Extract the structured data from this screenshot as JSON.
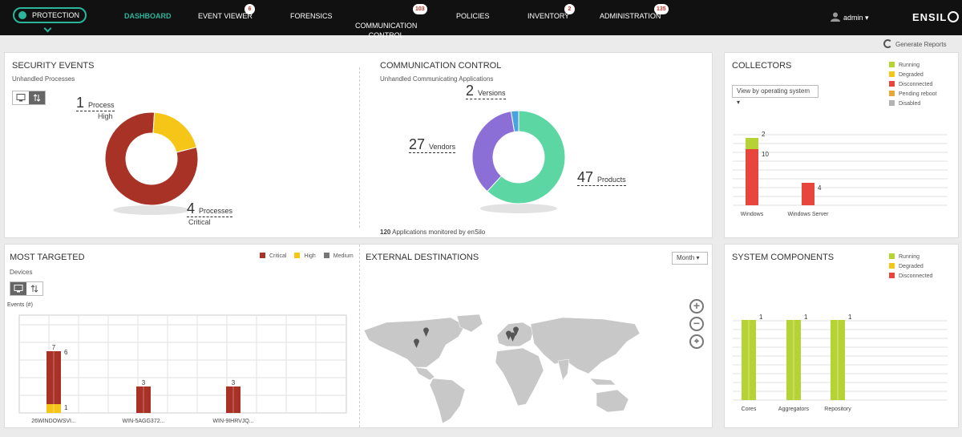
{
  "nav": {
    "protection": "PROTECTION",
    "items": [
      {
        "label": "DASHBOARD",
        "badge": ""
      },
      {
        "label": "EVENT VIEWER",
        "badge": "6"
      },
      {
        "label": "FORENSICS",
        "badge": ""
      },
      {
        "label": "COMMUNICATION\nCONTROL",
        "badge": "103"
      },
      {
        "label": "POLICIES",
        "badge": ""
      },
      {
        "label": "INVENTORY",
        "badge": "2"
      },
      {
        "label": "ADMINISTRATION",
        "badge": "135"
      }
    ],
    "user": "admin",
    "logo": "ENSIL"
  },
  "toolbar": {
    "generate_reports": "Generate Reports"
  },
  "security_events": {
    "title": "SECURITY EVENTS",
    "subtitle": "Unhandled Processes",
    "high_count": "1",
    "high_unit": "Process",
    "high_label": "High",
    "critical_count": "4",
    "critical_unit": "Processes",
    "critical_label": "Critical"
  },
  "communication_control": {
    "title": "COMMUNICATION CONTROL",
    "subtitle": "Unhandled Communicating Applications",
    "versions_count": "2",
    "versions_label": "Versions",
    "vendors_count": "27",
    "vendors_label": "Vendors",
    "products_count": "47",
    "products_label": "Products",
    "footer_count": "120",
    "footer_text": "Applications monitored by enSilo"
  },
  "collectors": {
    "title": "COLLECTORS",
    "dropdown": "View by operating system",
    "legend": [
      {
        "label": "Running",
        "color": "#b5d334"
      },
      {
        "label": "Degraded",
        "color": "#f5c518"
      },
      {
        "label": "Disconnected",
        "color": "#e8453c"
      },
      {
        "label": "Pending reboot",
        "color": "#e8a838"
      },
      {
        "label": "Disabled",
        "color": "#b3b3b3"
      }
    ]
  },
  "most_targeted": {
    "title": "MOST TARGETED",
    "subtitle": "Devices",
    "y_label": "Events (#)",
    "legend": [
      {
        "label": "Critical",
        "color": "#a93226"
      },
      {
        "label": "High",
        "color": "#f5c518"
      },
      {
        "label": "Medium",
        "color": "#777777"
      }
    ]
  },
  "external_destinations": {
    "title": "EXTERNAL DESTINATIONS",
    "period": "Month"
  },
  "system_components": {
    "title": "SYSTEM COMPONENTS",
    "legend": [
      {
        "label": "Running",
        "color": "#b5d334"
      },
      {
        "label": "Degraded",
        "color": "#f5c518"
      },
      {
        "label": "Disconnected",
        "color": "#e8453c"
      }
    ]
  },
  "chart_data": [
    {
      "type": "pie",
      "chart": "security-events",
      "labels": [
        "Critical",
        "High"
      ],
      "values": [
        4,
        1
      ],
      "colors": [
        "#a93226",
        "#f5c518"
      ]
    },
    {
      "type": "pie",
      "chart": "communication-control",
      "labels": [
        "Products",
        "Vendors",
        "Versions"
      ],
      "values": [
        47,
        27,
        2
      ],
      "colors": [
        "#5cd6a2",
        "#8b6fd6",
        "#4aa3df"
      ]
    },
    {
      "type": "bar",
      "chart": "collectors",
      "categories": [
        "Windows",
        "Windows Server"
      ],
      "series": [
        {
          "name": "Disconnected",
          "values": [
            10,
            4
          ],
          "color": "#e8453c"
        },
        {
          "name": "Running",
          "values": [
            2,
            0
          ],
          "color": "#b5d334"
        }
      ]
    },
    {
      "type": "bar",
      "chart": "most-targeted",
      "categories": [
        "26WINDOWSVI...",
        "WIN-5AGG372...",
        "WIN-9IHRVJQ..."
      ],
      "totals": [
        7,
        3,
        3
      ],
      "series": [
        {
          "name": "Critical",
          "values": [
            6,
            3,
            3
          ],
          "color": "#a93226"
        },
        {
          "name": "High",
          "values": [
            1,
            0,
            0
          ],
          "color": "#f5c518"
        }
      ]
    },
    {
      "type": "bar",
      "chart": "system-components",
      "categories": [
        "Cores",
        "Aggregators",
        "Repository"
      ],
      "series": [
        {
          "name": "Running",
          "values": [
            1,
            1,
            1
          ],
          "color": "#b5d334"
        }
      ]
    }
  ]
}
